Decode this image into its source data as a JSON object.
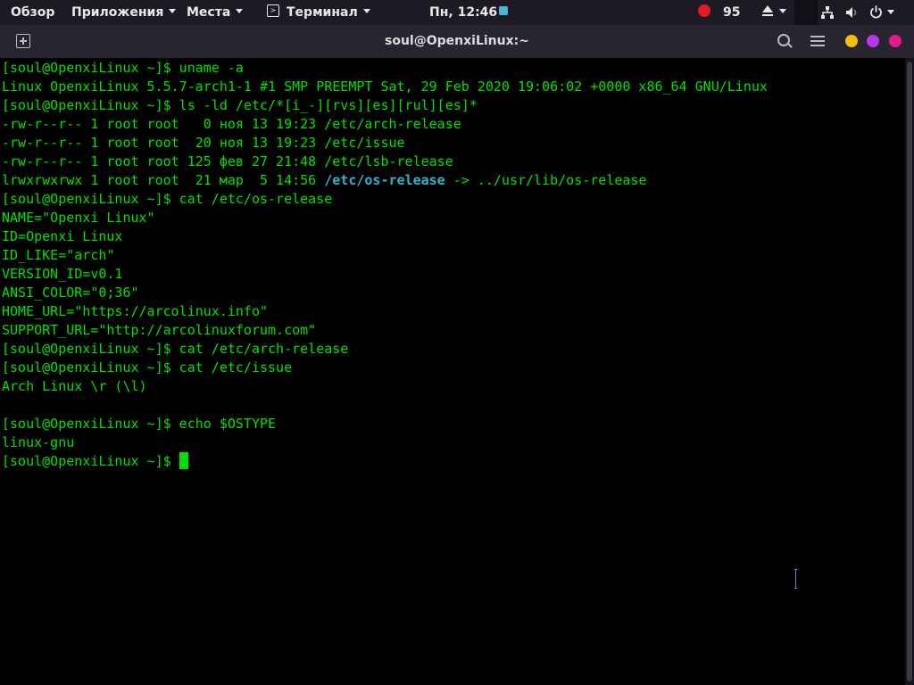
{
  "topbar": {
    "overview": "Обзор",
    "apps": "Приложения",
    "places": "Места",
    "app_menu": "Терминал",
    "clock": "Пн, 12:46",
    "updates_count": "95"
  },
  "header": {
    "title": "soul@OpenxiLinux:~",
    "controls": {
      "minimize_color": "#f0c20f",
      "maximize_color": "#b638e8",
      "close_color": "#e01b8e"
    }
  },
  "terminal": {
    "colors": {
      "text": "#00e000",
      "highlight": "#2fb3d0",
      "background": "#000000"
    },
    "lines": [
      "[soul@OpenxiLinux ~]$ uname -a",
      "Linux OpenxiLinux 5.5.7-arch1-1 #1 SMP PREEMPT Sat, 29 Feb 2020 19:06:02 +0000 x86_64 GNU/Linux",
      "[soul@OpenxiLinux ~]$ ls -ld /etc/*[i_-][rvs][es][rul][es]*",
      "-rw-r--r-- 1 root root   0 ноя 13 19:23 /etc/arch-release",
      "-rw-r--r-- 1 root root  20 ноя 13 19:23 /etc/issue",
      "-rw-r--r-- 1 root root 125 фев 27 21:48 /etc/lsb-release",
      {
        "before": "lrwxrwxrwx 1 root root  21 мар  5 14:56 ",
        "link": "/etc/os-release",
        "after": " -> ../usr/lib/os-release"
      },
      "[soul@OpenxiLinux ~]$ cat /etc/os-release",
      "NAME=\"Openxi Linux\"",
      "ID=Openxi Linux",
      "ID_LIKE=\"arch\"",
      "VERSION_ID=v0.1",
      "ANSI_COLOR=\"0;36\"",
      "HOME_URL=\"https://arcolinux.info\"",
      "SUPPORT_URL=\"http://arcolinuxforum.com\"",
      "[soul@OpenxiLinux ~]$ cat /etc/arch-release",
      "[soul@OpenxiLinux ~]$ cat /etc/issue",
      "Arch Linux \\r (\\l)",
      "",
      "[soul@OpenxiLinux ~]$ echo $OSTYPE",
      "linux-gnu"
    ],
    "prompt": "[soul@OpenxiLinux ~]$ "
  }
}
